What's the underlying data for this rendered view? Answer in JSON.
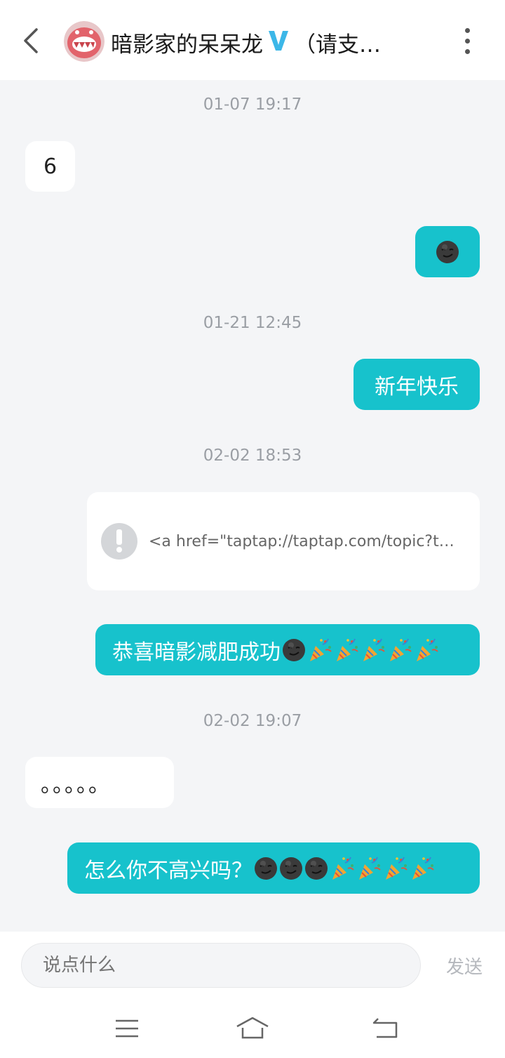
{
  "header": {
    "name": "暗影家的呆呆龙",
    "verified_badge": "V",
    "suffix": "（请支…",
    "icons": {
      "back": "chevron-left-icon",
      "more": "more-vertical-icon"
    }
  },
  "messages": [
    {
      "type": "timestamp",
      "text": "01-07 19:17"
    },
    {
      "type": "in",
      "text": "6"
    },
    {
      "type": "out",
      "text": "",
      "emoji": [
        "smirk-face"
      ]
    },
    {
      "type": "timestamp",
      "text": "01-21 12:45"
    },
    {
      "type": "out",
      "text": "新年快乐"
    },
    {
      "type": "timestamp",
      "text": "02-02 18:53"
    },
    {
      "type": "link-card",
      "text": "<a href=\"taptap://taptap.com/topic?t…",
      "icon": "exclamation-icon"
    },
    {
      "type": "out",
      "text": "恭喜暗影减肥成功",
      "emoji": [
        "smirk-face",
        "party-popper",
        "party-popper",
        "party-popper",
        "party-popper",
        "party-popper"
      ]
    },
    {
      "type": "timestamp",
      "text": "02-02 19:07"
    },
    {
      "type": "in",
      "text": "。。。。。"
    },
    {
      "type": "out",
      "text": "怎么你不高兴吗？",
      "emoji": [
        "smirk-face",
        "smirk-face",
        "smirk-face",
        "party-popper",
        "party-popper",
        "party-popper",
        "party-popper"
      ]
    }
  ],
  "composer": {
    "placeholder": "说点什么",
    "send_label": "发送"
  },
  "navbar": {
    "icons": [
      "menu-icon",
      "home-icon",
      "back-nav-icon"
    ]
  },
  "colors": {
    "outgoing_bubble": "#17c2cc",
    "incoming_bubble": "#ffffff",
    "background": "#f4f5f7",
    "verified": "#3cb7e8"
  }
}
